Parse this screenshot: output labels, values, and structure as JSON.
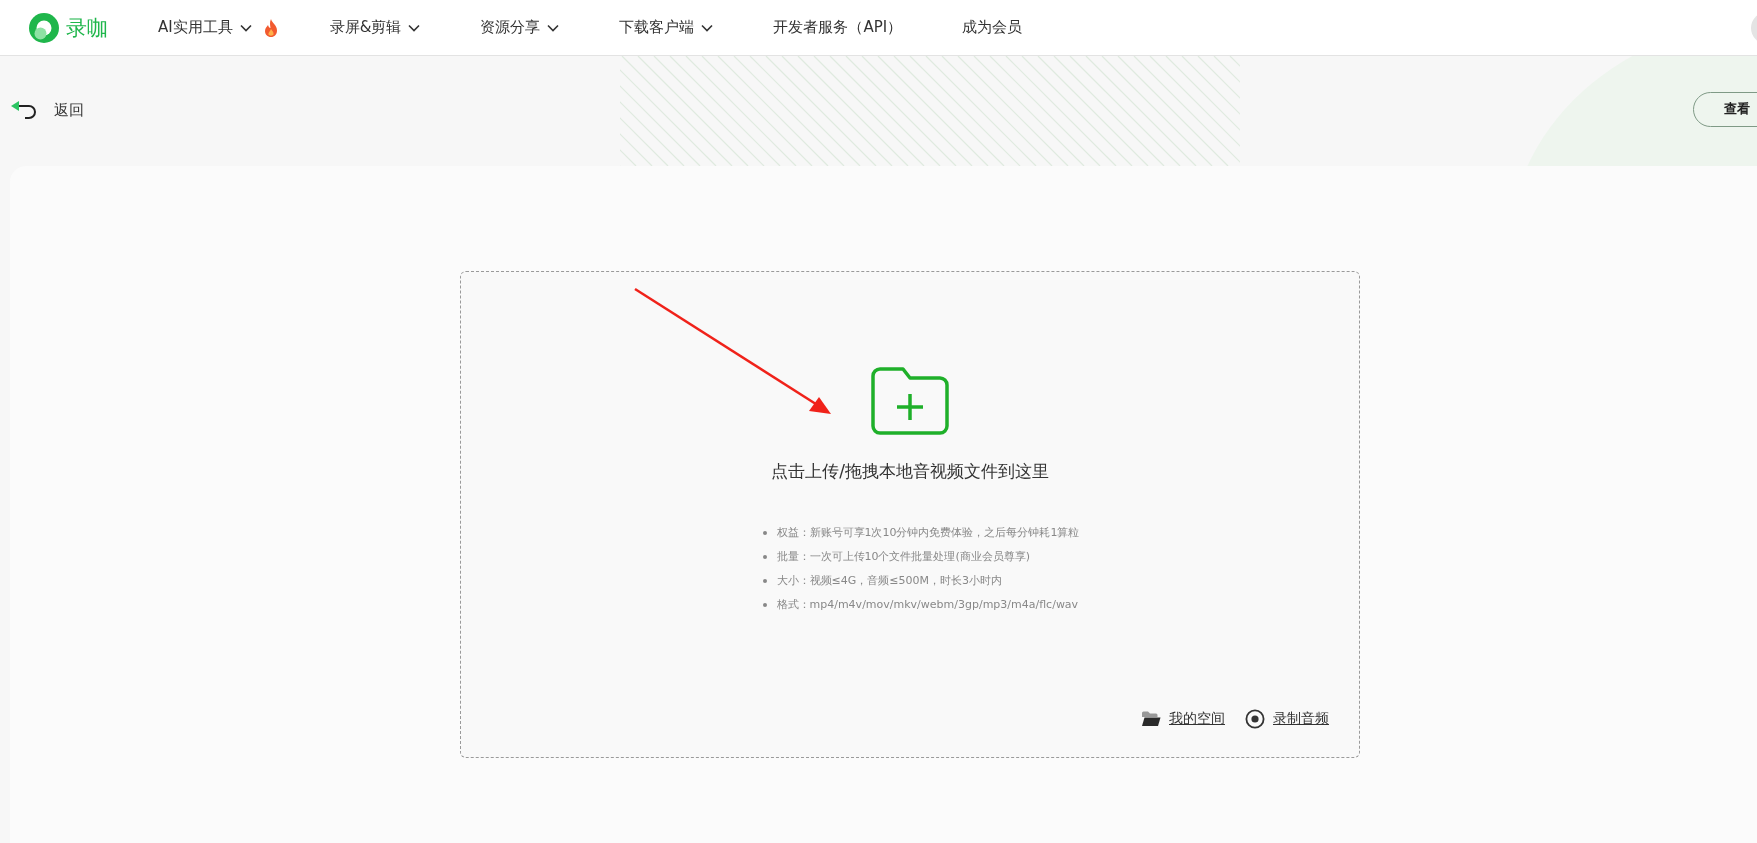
{
  "logo": {
    "text": "录咖"
  },
  "nav": [
    {
      "label": "AI实用工具",
      "dropdown": true,
      "hot": true
    },
    {
      "label": "录屏&剪辑",
      "dropdown": true,
      "hot": false
    },
    {
      "label": "资源分享",
      "dropdown": true,
      "hot": false
    },
    {
      "label": "下载客户端",
      "dropdown": true,
      "hot": false
    },
    {
      "label": "开发者服务（API）",
      "dropdown": false,
      "hot": false
    },
    {
      "label": "成为会员",
      "dropdown": false,
      "hot": false
    }
  ],
  "back": {
    "label": "返回"
  },
  "top_right_button": {
    "label": "查看"
  },
  "upload": {
    "title": "点击上传/拖拽本地音视频文件到这里",
    "tips": [
      "权益：新账号可享1次10分钟内免费体验，之后每分钟耗1算粒",
      "批量：一次可上传10个文件批量处理(商业会员尊享)",
      "大小：视频≤4G，音频≤500M，时长3小时内",
      "格式：mp4/m4v/mov/mkv/webm/3gp/mp3/m4a/flc/wav"
    ],
    "links": [
      {
        "kind": "folder",
        "label": "我的空间"
      },
      {
        "kind": "record",
        "label": "录制音频"
      }
    ]
  }
}
